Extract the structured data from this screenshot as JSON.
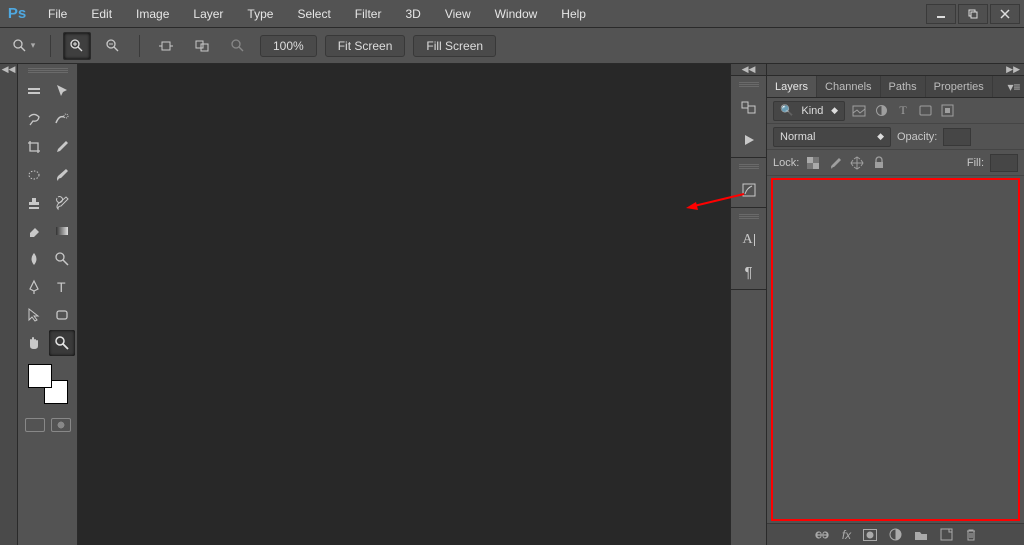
{
  "app": {
    "logo": "Ps"
  },
  "menu": [
    "File",
    "Edit",
    "Image",
    "Layer",
    "Type",
    "Select",
    "Filter",
    "3D",
    "View",
    "Window",
    "Help"
  ],
  "options": {
    "zoom": "100%",
    "fit": "Fit Screen",
    "fill": "Fill Screen"
  },
  "panels": {
    "tabs": [
      "Layers",
      "Channels",
      "Paths",
      "Properties"
    ],
    "active_tab": "Layers",
    "kind": "Kind",
    "blend_mode": "Normal",
    "opacity_label": "Opacity:",
    "lock_label": "Lock:",
    "fill_label": "Fill:"
  },
  "footer_icons": [
    "link",
    "fx",
    "mask",
    "adjust",
    "group",
    "new",
    "trash"
  ],
  "colors": {
    "fg": "#ffffff",
    "bg": "#ffffff"
  }
}
